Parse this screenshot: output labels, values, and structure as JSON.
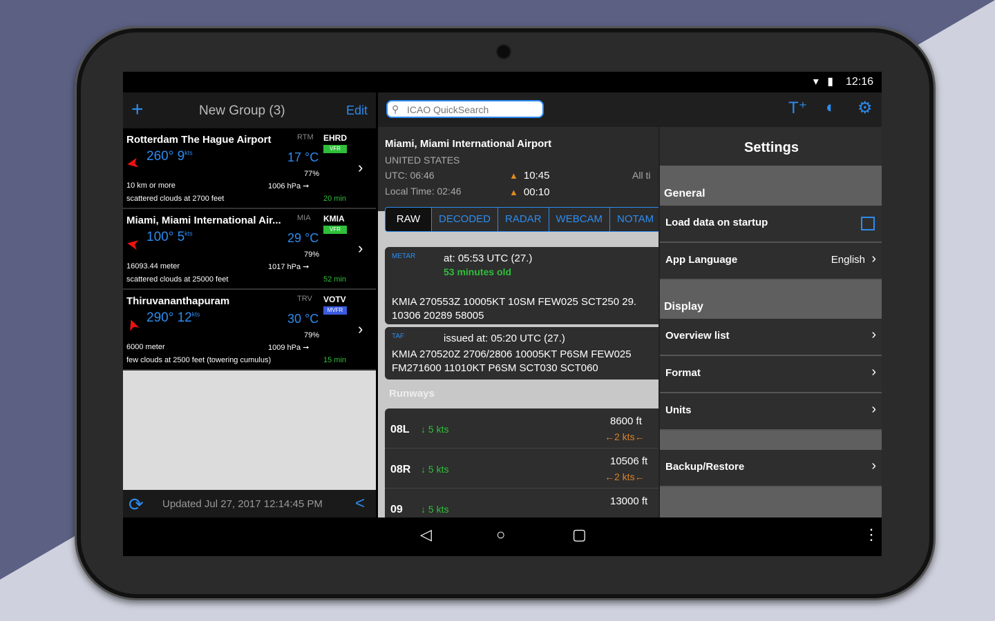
{
  "status": {
    "time": "12:16",
    "icons": "▾ ▮"
  },
  "left": {
    "plus": "+",
    "group_title": "New Group (3)",
    "edit": "Edit",
    "airports": [
      {
        "name": "Rotterdam The Hague Airport",
        "iata": "RTM",
        "icao": "EHRD",
        "badge": "VFR",
        "badge_color": "#2fbf3a",
        "arrow": "➤",
        "wind": "260° 9",
        "wind_unit": "kts",
        "temp": "17 °C",
        "humidity": "77%",
        "visibility": "10 km or more",
        "pressure": "1006 hPa ➞",
        "clouds": "scattered clouds at 2700 feet",
        "age": "20 min"
      },
      {
        "name": "Miami, Miami International Air...",
        "iata": "MIA",
        "icao": "KMIA",
        "badge": "VFR",
        "badge_color": "#2fbf3a",
        "arrow": "➤",
        "wind": "100° 5",
        "wind_unit": "kts",
        "temp": "29 °C",
        "humidity": "79%",
        "visibility": "16093.44 meter",
        "pressure": "1017 hPa ➞",
        "clouds": "scattered clouds at 25000 feet",
        "age": "52 min"
      },
      {
        "name": "Thiruvananthapuram",
        "iata": "TRV",
        "icao": "VOTV",
        "badge": "MVFR",
        "badge_color": "#3a5be0",
        "arrow": "➤",
        "wind": "290° 12",
        "wind_unit": "kts",
        "temp": "30 °C",
        "humidity": "79%",
        "visibility": "6000 meter",
        "pressure": "1009 hPa ➞",
        "clouds": "few clouds at 2500 feet (towering cumulus)",
        "age": "15 min"
      }
    ],
    "updated": "Updated Jul 27, 2017 12:14:45 PM"
  },
  "right": {
    "search_placeholder": "ICAO QuickSearch",
    "airport_name": "Miami, Miami International Airport",
    "country": "UNITED STATES",
    "utc": "UTC: 06:46",
    "local_time": "Local Time: 02:46",
    "sunrise": "10:45",
    "sunset": "00:10",
    "all_times": "All ti",
    "tabs": [
      "RAW",
      "DECODED",
      "RADAR",
      "WEBCAM",
      "NOTAM"
    ],
    "metar": {
      "type": "METAR",
      "at": "at: 05:53 UTC (27.)",
      "old": "53 minutes old",
      "raw1": "KMIA 270553Z 10005KT 10SM FEW025 SCT250 29.",
      "raw2": "10306 20289 58005"
    },
    "taf": {
      "type": "TAF",
      "at": "issued at: 05:20 UTC  (27.)",
      "raw1": "KMIA 270520Z 2706/2806 10005KT P6SM FEW025",
      "raw2": "FM271600 11010KT P6SM SCT030 SCT060"
    },
    "runways_label": "Runways",
    "runways": [
      {
        "id": "08L",
        "wind": "↓ 5 kts",
        "length": "8600 ft",
        "cross": "←2  kts←"
      },
      {
        "id": "08R",
        "wind": "↓ 5 kts",
        "length": "10506 ft",
        "cross": "←2  kts←"
      },
      {
        "id": "09",
        "wind": "↓ 5 kts",
        "length": "13000 ft",
        "cross": ""
      }
    ]
  },
  "settings": {
    "title": "Settings",
    "general": "General",
    "load_data": "Load data on startup",
    "app_language": "App Language",
    "language_value": "English",
    "display": "Display",
    "overview_list": "Overview list",
    "format": "Format",
    "units": "Units",
    "backup": "Backup/Restore"
  },
  "navbar": {
    "back": "◁",
    "home": "○",
    "recent": "▢",
    "more": "⋮"
  }
}
